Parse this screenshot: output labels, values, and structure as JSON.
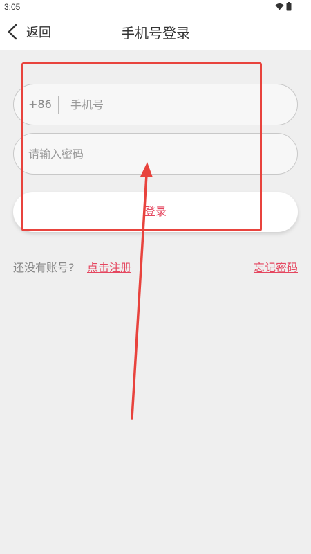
{
  "status_bar": {
    "time": "3:05",
    "icons": [
      "wifi-icon",
      "battery-icon"
    ]
  },
  "nav": {
    "back_label": "返回",
    "title": "手机号登录"
  },
  "phone": {
    "country_code": "+86",
    "placeholder": "手机号",
    "value": ""
  },
  "password": {
    "placeholder": "请输入密码",
    "value": ""
  },
  "login_button_label": "登录",
  "register": {
    "prompt": "还没有账号?",
    "link_label": "点击注册"
  },
  "forgot_label": "忘记密码",
  "colors": {
    "accent": "#e5465f",
    "annotation": "#e8433d",
    "background": "#efefef"
  }
}
